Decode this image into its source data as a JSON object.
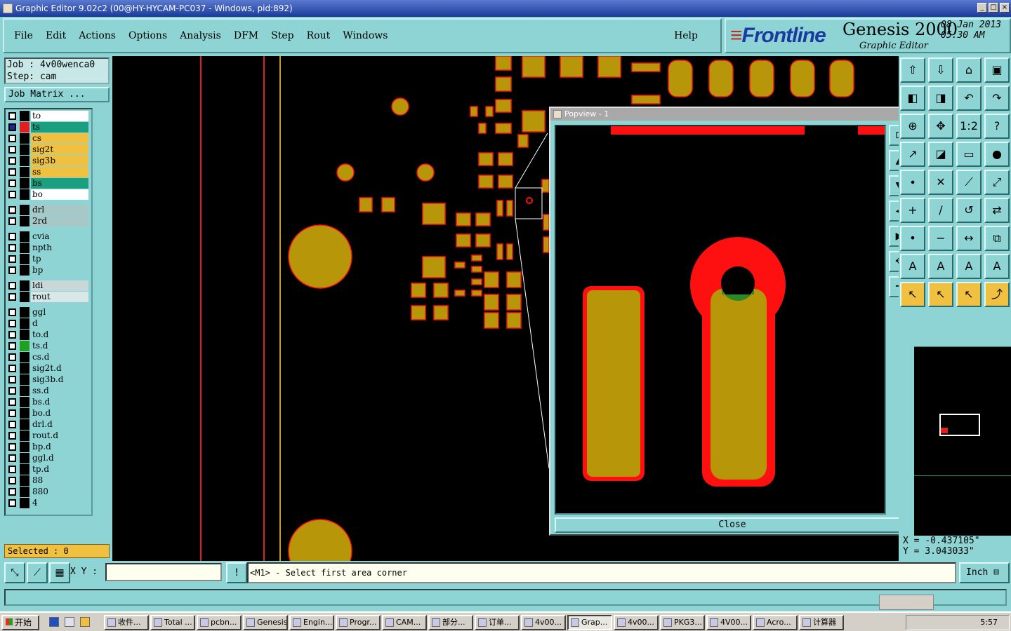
{
  "titlebar": {
    "title": "Graphic Editor 9.02c2 (00@HY-HYCAM-PC037 - Windows, pid:892)"
  },
  "menu": {
    "items": [
      "File",
      "Edit",
      "Actions",
      "Options",
      "Analysis",
      "DFM",
      "Step",
      "Rout",
      "Windows"
    ],
    "help": "Help"
  },
  "brand": {
    "logo_prefix": "F",
    "logo_rest": "rontline",
    "product": "Genesis 2000",
    "subtitle": "Graphic Editor",
    "date": "08 Jan 2013",
    "time": "05:30 AM"
  },
  "job": {
    "job_line": "Job : 4v00wenca0",
    "step_line": "Step: cam",
    "matrix_button": "Job Matrix ..."
  },
  "layers": [
    {
      "name": "to",
      "color": "#ffffff",
      "swatch": "#000000",
      "checked": false
    },
    {
      "name": "ts",
      "color": "#1aa080",
      "swatch": "#e02020",
      "checked": true
    },
    {
      "name": "cs",
      "color": "#f0c040",
      "swatch": "#000000",
      "checked": false
    },
    {
      "name": "sig2t",
      "color": "#f0c040",
      "swatch": "#000000",
      "checked": false
    },
    {
      "name": "sig3b",
      "color": "#f0c040",
      "swatch": "#000000",
      "checked": false
    },
    {
      "name": "ss",
      "color": "#f0c040",
      "swatch": "#000000",
      "checked": false
    },
    {
      "name": "bs",
      "color": "#1aa080",
      "swatch": "#000000",
      "checked": false
    },
    {
      "name": "bo",
      "color": "#ffffff",
      "swatch": "#000000",
      "checked": false
    },
    {
      "name": "drl",
      "color": "#a8c8c8",
      "swatch": "#000000",
      "checked": false
    },
    {
      "name": "2rd",
      "color": "#a8c8c8",
      "swatch": "#000000",
      "checked": false
    },
    {
      "name": "cvia",
      "color": "#8ed4d4",
      "swatch": "#000000",
      "checked": false
    },
    {
      "name": "npth",
      "color": "#8ed4d4",
      "swatch": "#000000",
      "checked": false
    },
    {
      "name": "tp",
      "color": "#8ed4d4",
      "swatch": "#000000",
      "checked": false
    },
    {
      "name": "bp",
      "color": "#8ed4d4",
      "swatch": "#000000",
      "checked": false
    },
    {
      "name": "ldi",
      "color": "#c8d8d8",
      "swatch": "#000000",
      "checked": false
    },
    {
      "name": "rout",
      "color": "#d8e8e8",
      "swatch": "#000000",
      "checked": false
    },
    {
      "name": "ggl",
      "color": "#8ed4d4",
      "swatch": "#000000",
      "checked": false
    },
    {
      "name": "d",
      "color": "#8ed4d4",
      "swatch": "#000000",
      "checked": false
    },
    {
      "name": "to.d",
      "color": "#8ed4d4",
      "swatch": "#000000",
      "checked": false
    },
    {
      "name": "ts.d",
      "color": "#8ed4d4",
      "swatch": "#20a020",
      "checked": false
    },
    {
      "name": "cs.d",
      "color": "#8ed4d4",
      "swatch": "#000000",
      "checked": false
    },
    {
      "name": "sig2t.d",
      "color": "#8ed4d4",
      "swatch": "#000000",
      "checked": false
    },
    {
      "name": "sig3b.d",
      "color": "#8ed4d4",
      "swatch": "#000000",
      "checked": false
    },
    {
      "name": "ss.d",
      "color": "#8ed4d4",
      "swatch": "#000000",
      "checked": false
    },
    {
      "name": "bs.d",
      "color": "#8ed4d4",
      "swatch": "#000000",
      "checked": false
    },
    {
      "name": "bo.d",
      "color": "#8ed4d4",
      "swatch": "#000000",
      "checked": false
    },
    {
      "name": "drl.d",
      "color": "#8ed4d4",
      "swatch": "#000000",
      "checked": false
    },
    {
      "name": "rout.d",
      "color": "#8ed4d4",
      "swatch": "#000000",
      "checked": false
    },
    {
      "name": "bp.d",
      "color": "#8ed4d4",
      "swatch": "#000000",
      "checked": false
    },
    {
      "name": "ggl.d",
      "color": "#8ed4d4",
      "swatch": "#000000",
      "checked": false
    },
    {
      "name": "tp.d",
      "color": "#8ed4d4",
      "swatch": "#000000",
      "checked": false
    },
    {
      "name": "88",
      "color": "#8ed4d4",
      "swatch": "#000000",
      "checked": false
    },
    {
      "name": "880",
      "color": "#8ed4d4",
      "swatch": "#000000",
      "checked": false
    },
    {
      "name": "4",
      "color": "#8ed4d4",
      "swatch": "#000000",
      "checked": false
    }
  ],
  "selected": "Selected : 0",
  "popview": {
    "title": "Popview - 1",
    "close": "Close"
  },
  "coords": {
    "x": "X = -0.437105\"",
    "y": "Y = 3.043033\""
  },
  "cmd": {
    "xy_label": "X Y :",
    "xy_value": "",
    "prompt": "<M1> - Select first area corner",
    "unit": "Inch"
  },
  "colors": {
    "panel": "#8ed4d4",
    "pad": "#b8960a",
    "mask": "#ff1010",
    "accent": "#f0c040"
  },
  "taskbar": {
    "start": "开始",
    "tasks": [
      "收件...",
      "Total ...",
      "pcbn...",
      "Genesis",
      "Engin...",
      "Progr...",
      "CAM...",
      "部分...",
      "订单...",
      "4v00...",
      "Grap...",
      "4v00...",
      "PKG3...",
      "4V00...",
      "Acro...",
      "计算器"
    ],
    "clock": "5:57"
  }
}
